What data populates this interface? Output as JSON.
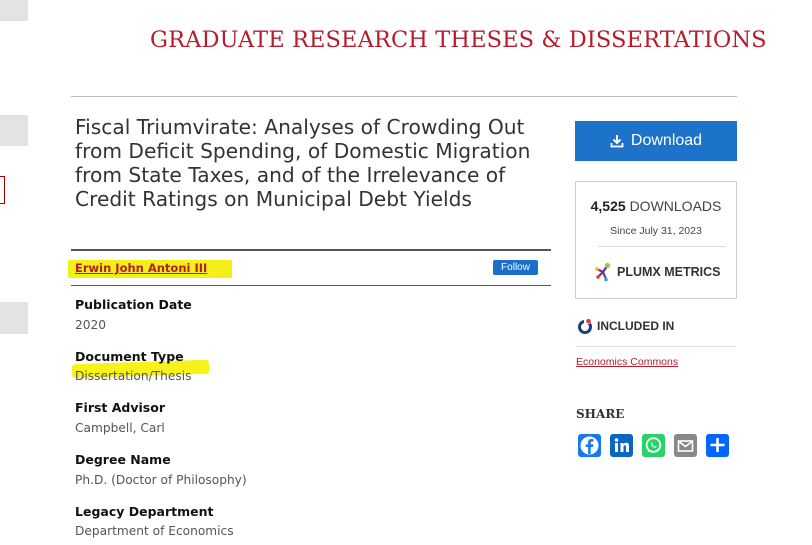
{
  "site": {
    "title": "GRADUATE RESEARCH THESES & DISSERTATIONS"
  },
  "document": {
    "title": "Fiscal Triumvirate: Analyses of Crowding Out from Deficit Spending, of Domestic Migration from State Taxes, and of the Irrelevance of Credit Ratings on Municipal Debt Yields",
    "author": "Erwin John Antoni III",
    "follow_label": "Follow"
  },
  "metadata": [
    {
      "label": "Publication Date",
      "value": "2020"
    },
    {
      "label": "Document Type",
      "value": "Dissertation/Thesis"
    },
    {
      "label": "First Advisor",
      "value": "Campbell, Carl"
    },
    {
      "label": "Degree Name",
      "value": "Ph.D. (Doctor of Philosophy)"
    },
    {
      "label": "Legacy Department",
      "value": "Department of Economics"
    }
  ],
  "sidebar": {
    "download_label": "Download",
    "downloads_count": "4,525",
    "downloads_label": "DOWNLOADS",
    "since": "Since July 31, 2023",
    "plumx_label": "PLUMX METRICS",
    "included_in_label": "INCLUDED IN",
    "commons_link": "Economics Commons",
    "share_label": "SHARE",
    "share_icons": [
      "facebook-icon",
      "linkedin-icon",
      "whatsapp-icon",
      "email-icon",
      "share-icon"
    ]
  },
  "colors": {
    "brand_red": "#b51c2c",
    "download_blue": "#1d73c9",
    "highlight": "#f4ef18"
  }
}
